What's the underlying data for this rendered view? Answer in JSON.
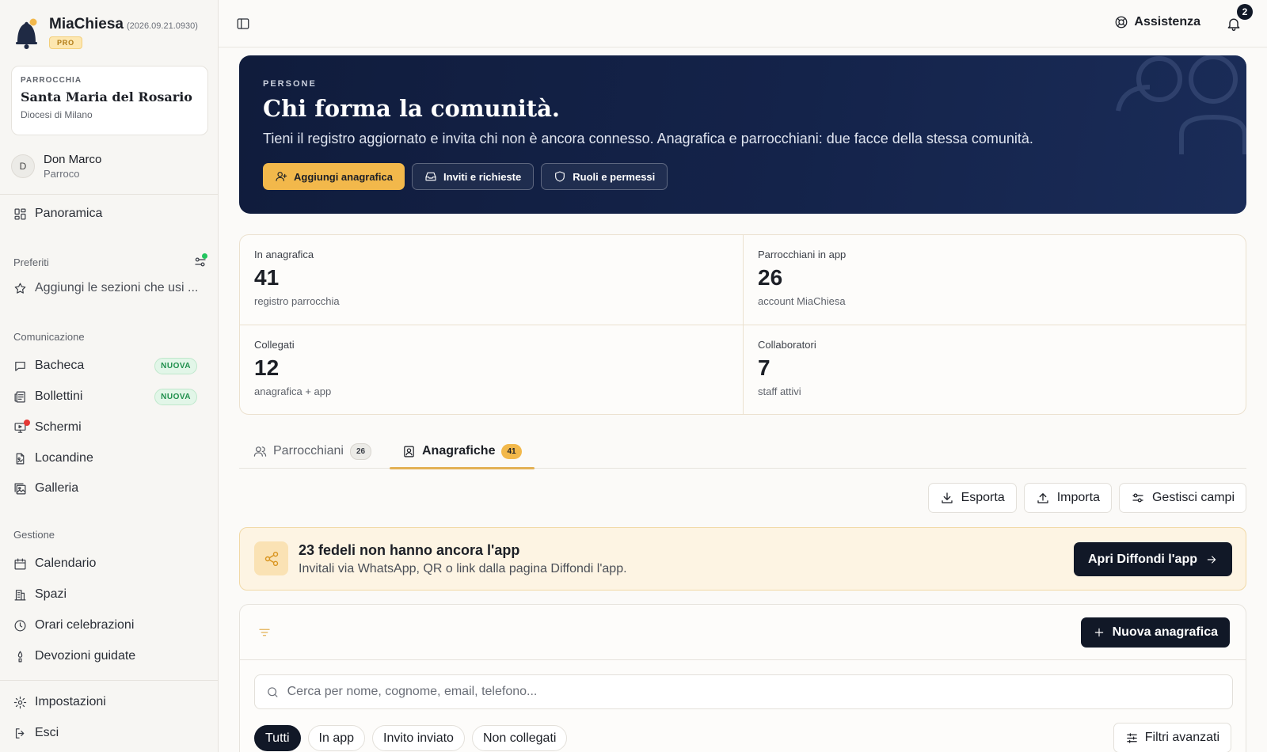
{
  "app": {
    "name": "MiaChiesa",
    "version": "(2026.09.21.0930)",
    "plan_badge": "PRO"
  },
  "parish": {
    "kicker": "PARROCCHIA",
    "name": "Santa Maria del Rosario",
    "diocese": "Diocesi di Milano"
  },
  "user": {
    "initial": "D",
    "name": "Don Marco",
    "role": "Parroco"
  },
  "sidebar": {
    "overview": "Panoramica",
    "favorites_label": "Preferiti",
    "favorites_hint": "Aggiungi le sezioni che usi ...",
    "communication_label": "Comunicazione",
    "communication_items": [
      {
        "label": "Bacheca",
        "badge": "NUOVA"
      },
      {
        "label": "Bollettini",
        "badge": "NUOVA"
      },
      {
        "label": "Schermi"
      },
      {
        "label": "Locandine"
      },
      {
        "label": "Galleria"
      }
    ],
    "management_label": "Gestione",
    "management_items": [
      {
        "label": "Calendario"
      },
      {
        "label": "Spazi"
      },
      {
        "label": "Orari celebrazioni"
      },
      {
        "label": "Devozioni guidate"
      }
    ],
    "settings": "Impostazioni",
    "logout": "Esci"
  },
  "topbar": {
    "help": "Assistenza",
    "notifications_count": "2"
  },
  "hero": {
    "kicker": "PERSONE",
    "title": "Chi forma la comunità.",
    "subtitle": "Tieni il registro aggiornato e invita chi non è ancora connesso. Anagrafica e parrocchiani: due facce della stessa comunità.",
    "actions": [
      "Aggiungi anagrafica",
      "Inviti e richieste",
      "Ruoli e permessi"
    ]
  },
  "stats": [
    {
      "label": "In anagrafica",
      "value": "41",
      "desc": "registro parrocchia"
    },
    {
      "label": "Parrocchiani in app",
      "value": "26",
      "desc": "account MiaChiesa"
    },
    {
      "label": "Collegati",
      "value": "12",
      "desc": "anagrafica + app"
    },
    {
      "label": "Collaboratori",
      "value": "7",
      "desc": "staff attivi"
    }
  ],
  "tabs": [
    {
      "label": "Parrocchiani",
      "count": "26"
    },
    {
      "label": "Anagrafiche",
      "count": "41",
      "active": true
    }
  ],
  "toolbar": {
    "export": "Esporta",
    "import": "Importa",
    "fields": "Gestisci campi"
  },
  "invite_banner": {
    "title": "23 fedeli non hanno ancora l'app",
    "subtitle": "Invitali via WhatsApp, QR o link dalla pagina Diffondi l'app.",
    "button": "Apri Diffondi l'app"
  },
  "list": {
    "new_button": "Nuova anagrafica",
    "search_placeholder": "Cerca per nome, cognome, email, telefono...",
    "filters": [
      "Tutti",
      "In app",
      "Invito inviato",
      "Non collegati"
    ],
    "active_filter": "Tutti",
    "advanced_filters": "Filtri avanzati"
  },
  "colors": {
    "accent": "#f2b84b",
    "hero_bg": "#14234a",
    "dark": "#111827",
    "success": "#1f8f4c"
  }
}
